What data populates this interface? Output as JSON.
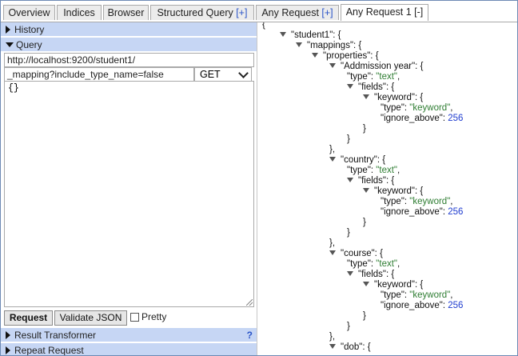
{
  "tabs": {
    "overview": "Overview",
    "indices": "Indices",
    "browser": "Browser",
    "structured": "Structured Query ",
    "structured_plus": "[+]",
    "any": "Any Request ",
    "any_plus": "[+]",
    "any1": "Any Request 1 [-]"
  },
  "left": {
    "history": "History",
    "query": "Query",
    "url": "http://localhost:9200/student1/",
    "path": "_mapping?include_type_name=false",
    "method": "GET",
    "body": "{}",
    "request_btn": "Request",
    "validate_btn": "Validate JSON",
    "pretty": "Pretty",
    "result_transformer": "Result Transformer",
    "help": "?",
    "repeat_request": "Repeat Request"
  },
  "json": {
    "open": "{",
    "student1": "\"student1\": {",
    "mappings": "\"mappings\": {",
    "properties": "\"properties\": {",
    "addmission": "\"Addmission year\": {",
    "type_key": "\"type\": ",
    "text_val": "\"text\"",
    "fields": "\"fields\": {",
    "keyword": "\"keyword\": {",
    "keyword_val": "\"keyword\"",
    "ignore_key": "\"ignore_above\": ",
    "ignore_val": "256",
    "close": "}",
    "close_comma": "},",
    "comma": ",",
    "country": "\"country\": {",
    "course": "\"course\": {",
    "dob": "\"dob\": {"
  },
  "colors": {
    "section_bg": "#c6d6f4",
    "string": "#2e7d32",
    "number": "#1f3ccf",
    "link": "#2a54c8"
  }
}
